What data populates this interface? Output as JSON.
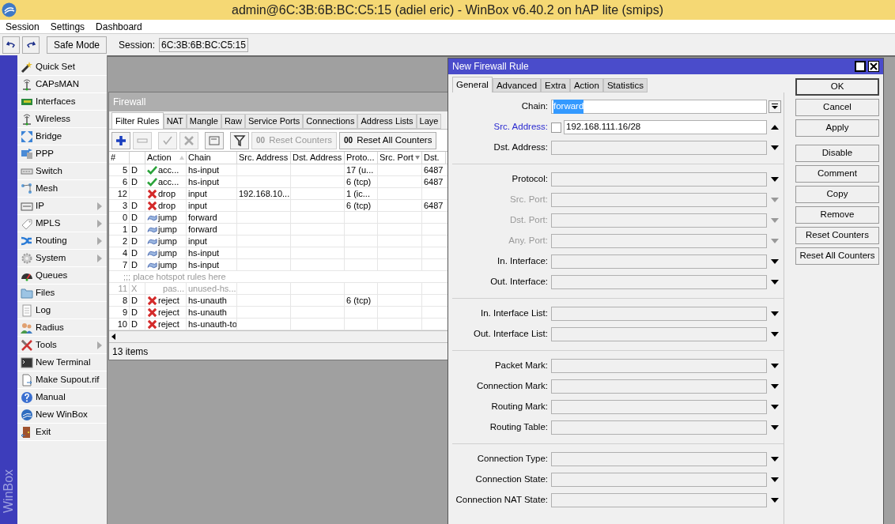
{
  "window": {
    "title": "admin@6C:3B:6B:BC:C5:15 (adiel eric) - WinBox v6.40.2 on hAP lite (smips)"
  },
  "menu": [
    "Session",
    "Settings",
    "Dashboard"
  ],
  "toolbar": {
    "safe_mode": "Safe Mode",
    "session_label": "Session:",
    "session_value": "6C:3B:6B:BC:C5:15"
  },
  "side_label": "WinBox",
  "sidebar": [
    {
      "label": "Quick Set",
      "submenu": false
    },
    {
      "label": "CAPsMAN",
      "submenu": false
    },
    {
      "label": "Interfaces",
      "submenu": false
    },
    {
      "label": "Wireless",
      "submenu": false
    },
    {
      "label": "Bridge",
      "submenu": false
    },
    {
      "label": "PPP",
      "submenu": false
    },
    {
      "label": "Switch",
      "submenu": false
    },
    {
      "label": "Mesh",
      "submenu": false
    },
    {
      "label": "IP",
      "submenu": true
    },
    {
      "label": "MPLS",
      "submenu": true
    },
    {
      "label": "Routing",
      "submenu": true
    },
    {
      "label": "System",
      "submenu": true
    },
    {
      "label": "Queues",
      "submenu": false
    },
    {
      "label": "Files",
      "submenu": false
    },
    {
      "label": "Log",
      "submenu": false
    },
    {
      "label": "Radius",
      "submenu": false
    },
    {
      "label": "Tools",
      "submenu": true
    },
    {
      "label": "New Terminal",
      "submenu": false
    },
    {
      "label": "Make Supout.rif",
      "submenu": false
    },
    {
      "label": "Manual",
      "submenu": false
    },
    {
      "label": "New WinBox",
      "submenu": false
    },
    {
      "label": "Exit",
      "submenu": false
    }
  ],
  "firewall": {
    "title": "Firewall",
    "tabs": [
      {
        "label": "Filter Rules",
        "selected": true
      },
      {
        "label": "NAT",
        "selected": false
      },
      {
        "label": "Mangle",
        "selected": false
      },
      {
        "label": "Raw",
        "selected": false
      },
      {
        "label": "Service Ports",
        "selected": false
      },
      {
        "label": "Connections",
        "selected": false
      },
      {
        "label": "Address Lists",
        "selected": false
      },
      {
        "label": "Laye",
        "selected": false
      }
    ],
    "tools": [
      {
        "kind": "add",
        "disabled": false
      },
      {
        "kind": "remove",
        "disabled": true
      },
      {
        "kind": "enable",
        "disabled": true
      },
      {
        "kind": "disable",
        "disabled": true
      },
      {
        "kind": "comment",
        "disabled": false
      },
      {
        "kind": "filter",
        "disabled": false
      },
      {
        "kind": "text",
        "prefix": "00",
        "label": "Reset Counters",
        "disabled": true
      },
      {
        "kind": "text",
        "prefix": "00",
        "label": "Reset All Counters",
        "disabled": false
      }
    ],
    "columns": [
      {
        "kind": "label",
        "label": "#"
      },
      {
        "kind": "blank"
      },
      {
        "kind": "sorted",
        "label": "Action"
      },
      {
        "kind": "label",
        "label": "Chain"
      },
      {
        "kind": "label",
        "label": "Src. Address"
      },
      {
        "kind": "label",
        "label": "Dst. Address"
      },
      {
        "kind": "label",
        "label": "Proto..."
      },
      {
        "kind": "filtered",
        "label": "Src. Port"
      },
      {
        "kind": "label",
        "label": "Dst."
      }
    ],
    "rows": [
      {
        "kind": "rule",
        "num": "5",
        "flag": "D",
        "action": {
          "kind": "accept",
          "label": "acc..."
        },
        "chain": "hs-input",
        "proto": "17 (u...",
        "dst": "6487",
        "disabled": false
      },
      {
        "kind": "rule",
        "num": "6",
        "flag": "D",
        "action": {
          "kind": "accept",
          "label": "acc..."
        },
        "chain": "hs-input",
        "proto": "6 (tcp)",
        "dst": "6487",
        "disabled": false
      },
      {
        "kind": "rule",
        "num": "12",
        "action": {
          "kind": "drop",
          "label": "drop"
        },
        "chain": "input",
        "src": "192.168.10...",
        "proto": "1 (ic...",
        "disabled": false
      },
      {
        "kind": "rule",
        "num": "3",
        "flag": "D",
        "action": {
          "kind": "drop",
          "label": "drop"
        },
        "chain": "input",
        "proto": "6 (tcp)",
        "dst": "6487",
        "disabled": false
      },
      {
        "kind": "rule",
        "num": "0",
        "flag": "D",
        "action": {
          "kind": "jump",
          "label": "jump"
        },
        "chain": "forward",
        "disabled": false
      },
      {
        "kind": "rule",
        "num": "1",
        "flag": "D",
        "action": {
          "kind": "jump",
          "label": "jump"
        },
        "chain": "forward",
        "disabled": false
      },
      {
        "kind": "rule",
        "num": "2",
        "flag": "D",
        "action": {
          "kind": "jump",
          "label": "jump"
        },
        "chain": "input",
        "disabled": false
      },
      {
        "kind": "rule",
        "num": "4",
        "flag": "D",
        "action": {
          "kind": "jump",
          "label": "jump"
        },
        "chain": "hs-input",
        "disabled": false
      },
      {
        "kind": "rule",
        "num": "7",
        "flag": "D",
        "action": {
          "kind": "jump",
          "label": "jump"
        },
        "chain": "hs-input",
        "disabled": false
      },
      {
        "kind": "comment",
        "text": ";;; place hotspot rules here"
      },
      {
        "kind": "rule",
        "num": "11",
        "flag": "X",
        "action": {
          "kind": "passthrough",
          "label": "pas..."
        },
        "chain": "unused-hs...",
        "disabled": true
      },
      {
        "kind": "rule",
        "num": "8",
        "flag": "D",
        "action": {
          "kind": "reject",
          "label": "reject"
        },
        "chain": "hs-unauth",
        "proto": "6 (tcp)",
        "disabled": false
      },
      {
        "kind": "rule",
        "num": "9",
        "flag": "D",
        "action": {
          "kind": "reject",
          "label": "reject"
        },
        "chain": "hs-unauth",
        "disabled": false
      },
      {
        "kind": "rule",
        "num": "10",
        "flag": "D",
        "action": {
          "kind": "reject",
          "label": "reject"
        },
        "chain": "hs-unauth-to",
        "disabled": false
      }
    ],
    "status": "13 items"
  },
  "dialog": {
    "title": "New Firewall Rule",
    "tabs": [
      {
        "label": "General",
        "selected": true
      },
      {
        "label": "Advanced",
        "selected": false
      },
      {
        "label": "Extra",
        "selected": false
      },
      {
        "label": "Action",
        "selected": false
      },
      {
        "label": "Statistics",
        "selected": false
      }
    ],
    "groups": [
      [
        {
          "label": "Chain:",
          "kind": "combo",
          "value": "forward",
          "emphasized": false,
          "disabled": false
        },
        {
          "label": "Src. Address:",
          "kind": "address",
          "value": "192.168.111.16/28",
          "negated": false,
          "emphasized": true,
          "disabled": false
        },
        {
          "label": "Dst. Address:",
          "kind": "select",
          "emphasized": false,
          "disabled": false
        }
      ],
      [
        {
          "label": "Protocol:",
          "kind": "select",
          "emphasized": false,
          "disabled": false
        },
        {
          "label": "Src. Port:",
          "kind": "select",
          "emphasized": false,
          "disabled": true
        },
        {
          "label": "Dst. Port:",
          "kind": "select",
          "emphasized": false,
          "disabled": true
        },
        {
          "label": "Any. Port:",
          "kind": "select",
          "emphasized": false,
          "disabled": true
        },
        {
          "label": "In. Interface:",
          "kind": "select",
          "emphasized": false,
          "disabled": false
        },
        {
          "label": "Out. Interface:",
          "kind": "select",
          "emphasized": false,
          "disabled": false
        }
      ],
      [
        {
          "label": "In. Interface List:",
          "kind": "select",
          "emphasized": false,
          "disabled": false
        },
        {
          "label": "Out. Interface List:",
          "kind": "select",
          "emphasized": false,
          "disabled": false
        }
      ],
      [
        {
          "label": "Packet Mark:",
          "kind": "select",
          "emphasized": false,
          "disabled": false
        },
        {
          "label": "Connection Mark:",
          "kind": "select",
          "emphasized": false,
          "disabled": false
        },
        {
          "label": "Routing Mark:",
          "kind": "select",
          "emphasized": false,
          "disabled": false
        },
        {
          "label": "Routing Table:",
          "kind": "select",
          "emphasized": false,
          "disabled": false
        }
      ],
      [
        {
          "label": "Connection Type:",
          "kind": "select",
          "emphasized": false,
          "disabled": false
        },
        {
          "label": "Connection State:",
          "kind": "select",
          "emphasized": false,
          "disabled": false
        },
        {
          "label": "Connection NAT State:",
          "kind": "select",
          "emphasized": false,
          "disabled": false
        }
      ]
    ],
    "button_groups": [
      [
        {
          "label": "OK",
          "default": true
        },
        {
          "label": "Cancel",
          "default": false
        },
        {
          "label": "Apply",
          "default": false
        }
      ],
      [
        {
          "label": "Disable",
          "default": false
        },
        {
          "label": "Comment",
          "default": false
        },
        {
          "label": "Copy",
          "default": false
        },
        {
          "label": "Remove",
          "default": false
        },
        {
          "label": "Reset Counters",
          "default": false
        },
        {
          "label": "Reset All Counters",
          "default": false
        }
      ]
    ]
  }
}
